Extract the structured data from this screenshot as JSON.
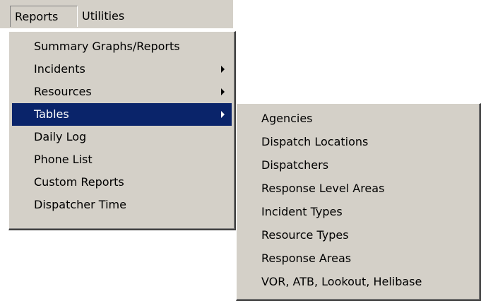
{
  "menubar": {
    "items": [
      {
        "label": "Reports"
      },
      {
        "label": "Utilities"
      }
    ]
  },
  "reports_menu": {
    "items": [
      {
        "label": "Summary Graphs/Reports",
        "has_submenu": false
      },
      {
        "label": "Incidents",
        "has_submenu": true
      },
      {
        "label": "Resources",
        "has_submenu": true
      },
      {
        "label": "Tables",
        "has_submenu": true,
        "selected": true
      },
      {
        "label": "Daily Log",
        "has_submenu": false
      },
      {
        "label": "Phone List",
        "has_submenu": false
      },
      {
        "label": "Custom Reports",
        "has_submenu": false
      },
      {
        "label": "Dispatcher Time",
        "has_submenu": false
      }
    ]
  },
  "tables_submenu": {
    "items": [
      {
        "label": "Agencies"
      },
      {
        "label": "Dispatch Locations"
      },
      {
        "label": "Dispatchers"
      },
      {
        "label": "Response Level Areas"
      },
      {
        "label": "Incident Types"
      },
      {
        "label": "Resource Types"
      },
      {
        "label": "Response Areas"
      },
      {
        "label": "VOR, ATB, Lookout, Helibase"
      }
    ]
  },
  "colors": {
    "menu_background": "#d4d0c8",
    "highlight": "#0a246a",
    "highlight_text": "#ffffff"
  }
}
